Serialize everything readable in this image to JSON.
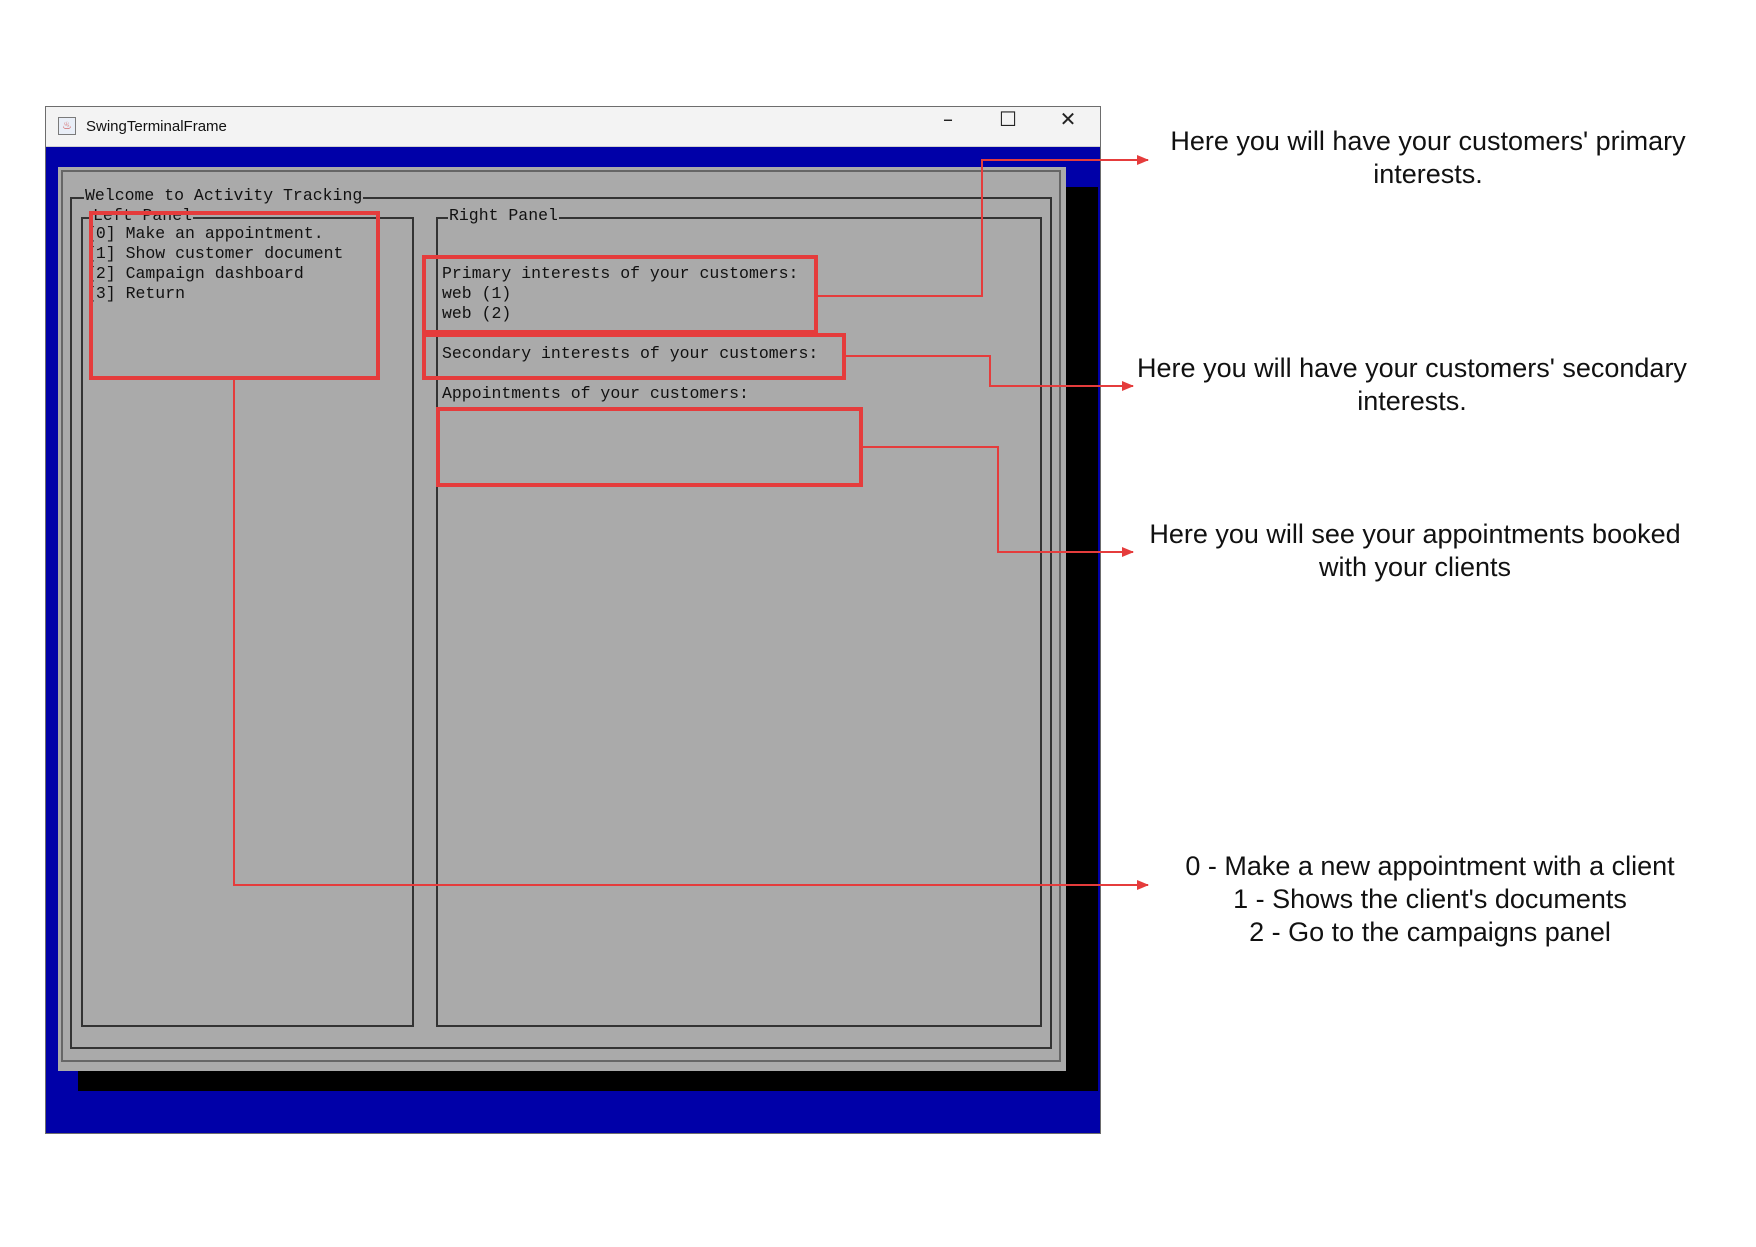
{
  "window": {
    "title": "SwingTerminalFrame",
    "controls": {
      "minimize": "–",
      "maximize": "☐",
      "close": "✕"
    },
    "icon": "java-app-icon"
  },
  "terminal": {
    "outer_title": "Welcome to Activity Tracking",
    "left_panel": {
      "title": "Left Panel",
      "menu": [
        "[0] Make an appointment.",
        "[1] Show customer document",
        "[2] Campaign dashboard",
        "[3] Return"
      ]
    },
    "right_panel": {
      "title": "Right Panel",
      "primary_heading": "Primary interests of your customers:",
      "primary_items": [
        "web (1)",
        "web (2)"
      ],
      "secondary_heading": "Secondary interests of your customers:",
      "appointments_heading": "Appointments of your customers:"
    }
  },
  "annotations": {
    "primary": "Here you will have your customers' primary interests.",
    "secondary": "Here you will have your customers' secondary interests.",
    "appointments": "Here you will see your appointments booked with your clients",
    "menu": [
      "0 - Make a new appointment with a client",
      "1 - Shows the client's documents",
      "2 - Go to the campaigns panel"
    ]
  },
  "colors": {
    "terminal_bg": "#aaaaaa",
    "window_bg": "#0000a8",
    "annotation_red": "#e53c3c"
  }
}
